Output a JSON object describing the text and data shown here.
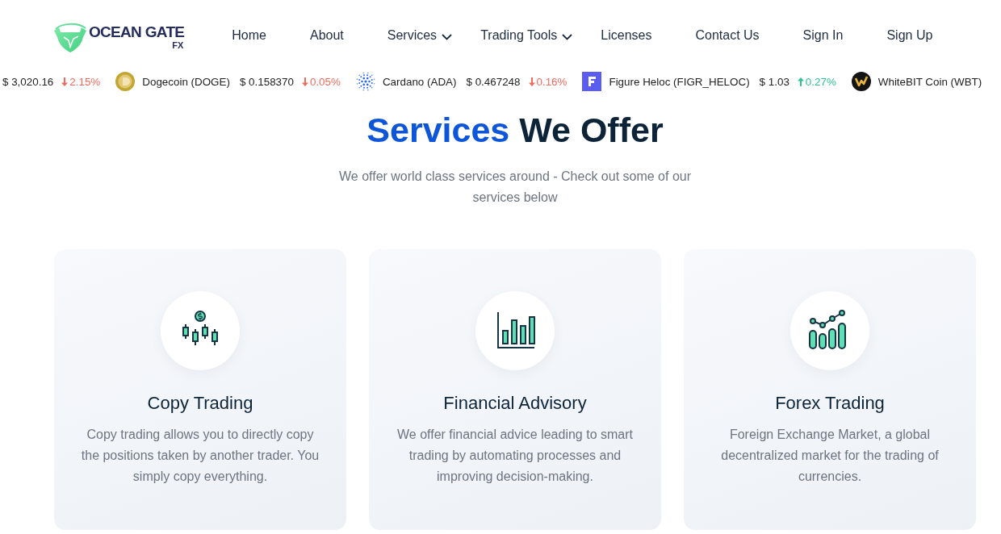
{
  "logo": {
    "name": "OCEAN GATE",
    "suffix": "FX"
  },
  "nav": [
    {
      "label": "Home",
      "dropdown": false
    },
    {
      "label": "About",
      "dropdown": false
    },
    {
      "label": "Services",
      "dropdown": true
    },
    {
      "label": "Trading Tools",
      "dropdown": true
    },
    {
      "label": "Licenses",
      "dropdown": false
    },
    {
      "label": "Contact Us",
      "dropdown": false
    },
    {
      "label": "Sign In",
      "dropdown": false
    },
    {
      "label": "Sign Up",
      "dropdown": false
    }
  ],
  "ticker": [
    {
      "price": "$ 3,020.16",
      "change": "2.15%",
      "rising": false
    },
    {
      "name": "Dogecoin (DOGE)",
      "price": "$ 0.158370",
      "change": "0.05%",
      "rising": false
    },
    {
      "name": "Cardano (ADA)",
      "price": "$ 0.467248",
      "change": "0.16%",
      "rising": false
    },
    {
      "name": "Figure Heloc (FIGR_HELOC)",
      "price": "$ 1.03",
      "change": "0.27%",
      "rising": true
    },
    {
      "name": "WhiteBIT Coin (WBT)"
    }
  ],
  "section": {
    "title": {
      "accent": "Services",
      "rest": "We Offer"
    },
    "subtitle": "We offer world class services around - Check out some of our services below",
    "cards": [
      {
        "title": "Copy Trading",
        "text": "Copy trading allows you to directly copy the positions taken by another trader. You simply copy everything."
      },
      {
        "title": "Financial Advisory",
        "text": "We offer financial advice leading to smart trading by automating processes and improving decision-making."
      },
      {
        "title": "Forex Trading",
        "text": "Foreign Exchange Market, a global decentralized market for the trading of currencies."
      }
    ]
  }
}
